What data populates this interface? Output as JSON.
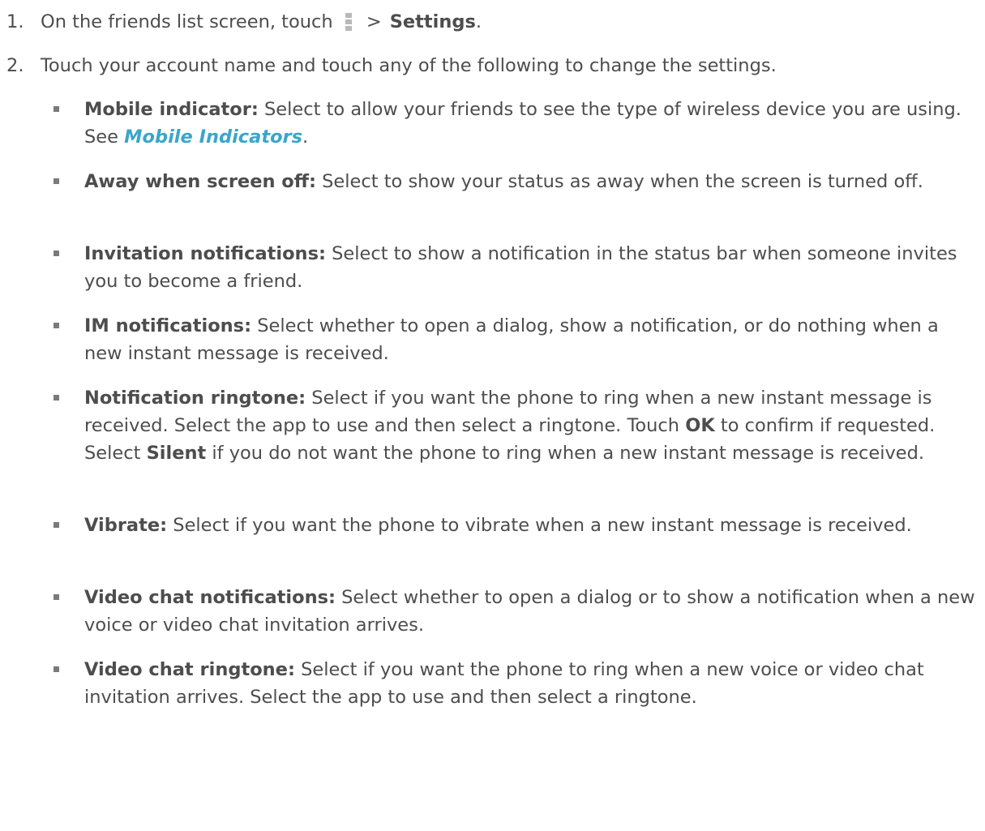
{
  "steps": [
    {
      "number": "1.",
      "text_before": "On the friends list screen, touch",
      "icon": "overflow-menu-icon",
      "separator": ">",
      "target": "Settings",
      "text_after": "."
    },
    {
      "number": "2.",
      "text": "Touch your account name and touch any of the following to change the settings."
    }
  ],
  "bullets": {
    "mobile_indicator": {
      "label": "Mobile indicator:",
      "text": " Select to allow your friends to see the type of wireless device you are using. See ",
      "link": "Mobile Indicators",
      "end": "."
    },
    "away_when_screen_off": {
      "label": "Away when screen off:",
      "text": " Select to show your status as away when the screen is turned off."
    },
    "invitation_notifications": {
      "label": "Invitation notifications:",
      "text": " Select to show a notification in the status bar when someone invites you to become a friend."
    },
    "im_notifications": {
      "label": "IM notifications:",
      "text": " Select whether to open a dialog, show a notification, or do nothing when a new instant message is received."
    },
    "notification_ringtone": {
      "label": "Notification ringtone:",
      "text_1": " Select if you want the phone to ring when a new instant message is received. Select the app to use and then select a ringtone. Touch ",
      "ok": "OK",
      "text_2": " to confirm if requested. Select ",
      "silent": "Silent",
      "text_3": " if you do not want the phone to ring when a new instant message is received."
    },
    "vibrate": {
      "label": "Vibrate:",
      "text": " Select if you want the phone to vibrate when a new instant message is received."
    },
    "video_chat_notifications": {
      "label": "Video chat notifications:",
      "text": " Select whether to open a dialog or to show a notification when a new voice or video chat invitation arrives."
    },
    "video_chat_ringtone": {
      "label": "Video chat ringtone:",
      "text": " Select if you want the phone to ring when a new voice or video chat invitation arrives. Select the app to use and then select a ringtone."
    }
  },
  "colors": {
    "body_text": "#4d4d4d",
    "link": "#3aa6c9",
    "bullet": "#7a7a7a",
    "icon": "#b9b9b9"
  }
}
